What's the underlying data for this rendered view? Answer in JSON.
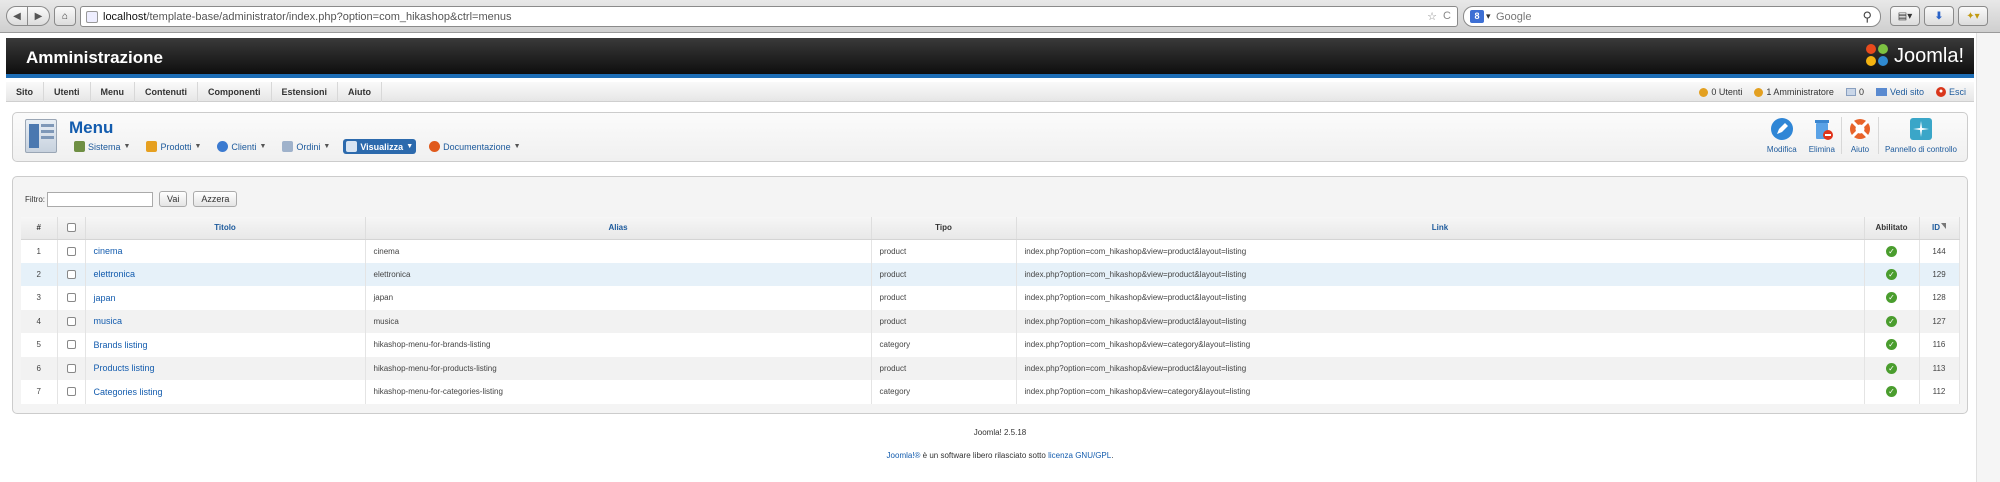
{
  "browser": {
    "url_host": "localhost",
    "url_path": "/template-base/administrator/index.php?option=com_hikashop&ctrl=menus",
    "search_placeholder": "Google",
    "search_engine_letter": "8"
  },
  "header": {
    "title": "Amministrazione",
    "logo_text": "Joomla!"
  },
  "menubar": {
    "items": [
      "Sito",
      "Utenti",
      "Menu",
      "Contenuti",
      "Componenti",
      "Estensioni",
      "Aiuto"
    ],
    "status": {
      "users": "0 Utenti",
      "admins": "1 Amministratore",
      "messages": "0",
      "view_site": "Vedi sito",
      "exit": "Esci"
    }
  },
  "toolbar": {
    "page_title": "Menu",
    "submenu": [
      {
        "label": "Sistema",
        "icon": "tools-icon",
        "color": "#5a7d3a"
      },
      {
        "label": "Prodotti",
        "icon": "products-icon",
        "color": "#e6a020"
      },
      {
        "label": "Clienti",
        "icon": "customers-icon",
        "color": "#3b7ad0"
      },
      {
        "label": "Ordini",
        "icon": "orders-icon",
        "color": "#8aa0c0"
      },
      {
        "label": "Visualizza",
        "icon": "display-icon",
        "color": "#ffffff"
      },
      {
        "label": "Documentazione",
        "icon": "help-icon",
        "color": "#e05a1c"
      }
    ],
    "actions": {
      "edit": "Modifica",
      "delete": "Elimina",
      "help": "Aiuto",
      "cpanel": "Pannello di controllo"
    }
  },
  "filter": {
    "label": "Filtro:",
    "value": "",
    "go": "Vai",
    "reset": "Azzera"
  },
  "table": {
    "headers": {
      "num": "#",
      "title": "Titolo",
      "alias": "Alias",
      "type": "Tipo",
      "link": "Link",
      "enabled": "Abilitato",
      "id": "ID"
    },
    "rows": [
      {
        "num": "1",
        "title": "cinema",
        "alias": "cinema",
        "type": "product",
        "link": "index.php?option=com_hikashop&view=product&layout=listing",
        "id": "144"
      },
      {
        "num": "2",
        "title": "elettronica",
        "alias": "elettronica",
        "type": "product",
        "link": "index.php?option=com_hikashop&view=product&layout=listing",
        "id": "129"
      },
      {
        "num": "3",
        "title": "japan",
        "alias": "japan",
        "type": "product",
        "link": "index.php?option=com_hikashop&view=product&layout=listing",
        "id": "128"
      },
      {
        "num": "4",
        "title": "musica",
        "alias": "musica",
        "type": "product",
        "link": "index.php?option=com_hikashop&view=product&layout=listing",
        "id": "127"
      },
      {
        "num": "5",
        "title": "Brands listing",
        "alias": "hikashop-menu-for-brands-listing",
        "type": "category",
        "link": "index.php?option=com_hikashop&view=category&layout=listing",
        "id": "116"
      },
      {
        "num": "6",
        "title": "Products listing",
        "alias": "hikashop-menu-for-products-listing",
        "type": "product",
        "link": "index.php?option=com_hikashop&view=product&layout=listing",
        "id": "113"
      },
      {
        "num": "7",
        "title": "Categories listing",
        "alias": "hikashop-menu-for-categories-listing",
        "type": "category",
        "link": "index.php?option=com_hikashop&view=category&layout=listing",
        "id": "112"
      }
    ]
  },
  "footer": {
    "version": "Joomla! 2.5.18",
    "license_prefix": "Joomla!®",
    "license_middle": " è un software libero rilasciato sotto ",
    "license_link": "licenza GNU/GPL",
    "license_suffix": "."
  },
  "colors": {
    "accent": "#135cae",
    "header_stripe": "#1d6db5",
    "enabled": "#4a9d2e",
    "highlight_row": "#e6f1f9"
  }
}
